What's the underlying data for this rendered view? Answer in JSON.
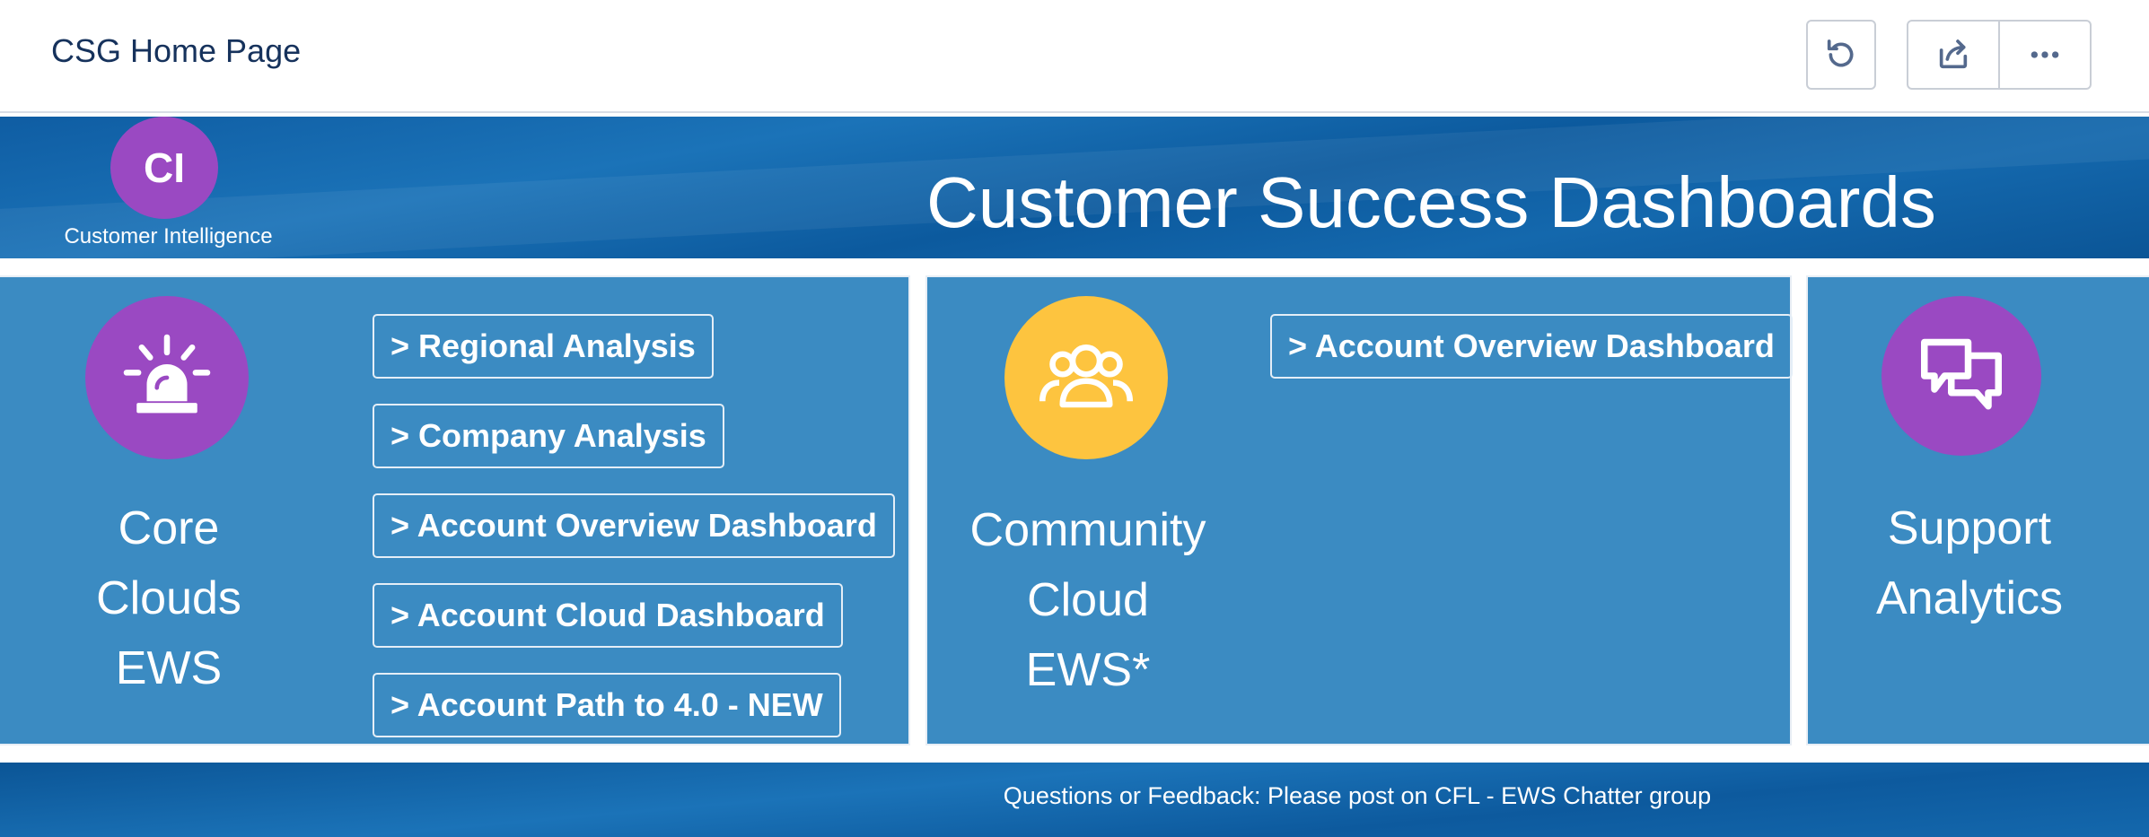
{
  "header": {
    "title": "CSG Home Page",
    "buttons": [
      {
        "name": "refresh",
        "icon": "refresh-icon"
      },
      {
        "name": "share",
        "icon": "share-icon"
      },
      {
        "name": "more",
        "icon": "more-actions-icon"
      }
    ]
  },
  "banner": {
    "logo_initials": "CI",
    "logo_caption": "Customer Intelligence",
    "title": "Customer Success Dashboards",
    "logo_color": "#9a49c2"
  },
  "panels": [
    {
      "icon": "siren-alert-icon",
      "icon_color": "#9a49c2",
      "label_lines": [
        "Core",
        "Clouds",
        "EWS"
      ],
      "links": [
        "> Regional Analysis",
        "> Company Analysis",
        "> Account Overview Dashboard",
        "> Account Cloud Dashboard",
        "> Account Path to 4.0 - NEW"
      ]
    },
    {
      "icon": "group-icon",
      "icon_color": "#fdc43f",
      "label_lines": [
        "Community",
        "Cloud",
        "EWS*"
      ],
      "links": [
        "> Account Overview Dashboard"
      ]
    },
    {
      "icon": "chat-bubbles-icon",
      "icon_color": "#9a49c2",
      "label_lines": [
        "Support",
        "Analytics"
      ],
      "links": []
    }
  ],
  "footer": {
    "text": "Questions or Feedback: Please post on CFL - EWS Chatter group"
  },
  "colors": {
    "panel_bg": "#3b8bc2",
    "banner_bg": "#1468ad",
    "title_text": "#16325c"
  }
}
